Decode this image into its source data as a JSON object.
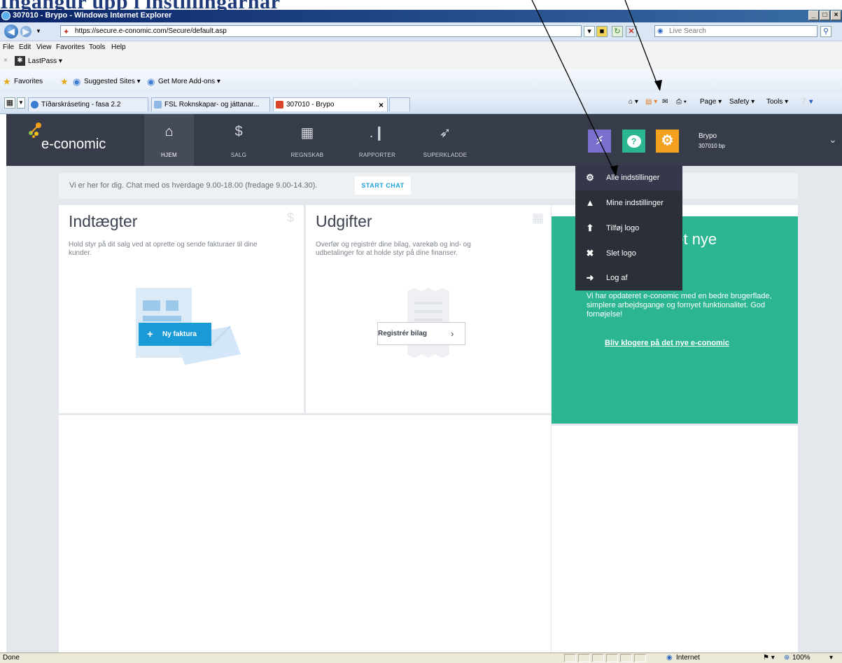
{
  "doc_heading": "Ingangur upp í instillingarnar",
  "window": {
    "title": "307010 - Brypo - Windows Internet Explorer",
    "controls": [
      "_",
      "□",
      "×"
    ]
  },
  "address_bar": {
    "url": "https://secure.e-conomic.com/Secure/default.asp",
    "search_placeholder": "Live Search"
  },
  "menu": [
    "File",
    "Edit",
    "View",
    "Favorites",
    "Tools",
    "Help"
  ],
  "lastpass": {
    "close": "×",
    "label": "LastPass ▾"
  },
  "favorites_bar": {
    "favorites": "Favorites",
    "suggested": "Suggested Sites ▾",
    "addons": "Get More Add-ons ▾"
  },
  "tabs": [
    {
      "label": "Tíðarskráseting - fasa 2.2"
    },
    {
      "label": "FSL Roknskapar- og játtanar..."
    },
    {
      "label": "307010 - Brypo"
    }
  ],
  "tab_close": "×",
  "command_bar": {
    "page": "Page ▾",
    "safety": "Safety ▾",
    "tools": "Tools ▾"
  },
  "app": {
    "logo": "e-conomic",
    "nav": [
      {
        "label": "HJEM",
        "icon": "⌂"
      },
      {
        "label": "SALG",
        "icon": "$"
      },
      {
        "label": "REGNSKAB",
        "icon": "▦"
      },
      {
        "label": "RAPPORTER",
        "icon": ".❙"
      },
      {
        "label": "SUPERKLADDE",
        "icon": "➶"
      }
    ],
    "user": {
      "name": "Brypo",
      "company": "307010 bp"
    },
    "colors": {
      "header": "#363c49",
      "lightning": "#7b6fd0",
      "chat": "#2bb590",
      "gear": "#f5a01f"
    }
  },
  "chat_bar": {
    "message": "Vi er her for dig. Chat med os hverdage 9.00-18.00 (fredage 9.00-14.30).",
    "button": "START CHAT"
  },
  "cards": {
    "income": {
      "title": "Indtægter",
      "desc_line1": "Hold styr på dit salg ved at oprette og sende fakturaer til dine",
      "desc_line2": "kunder.",
      "button": "Ny faktura"
    },
    "expenses": {
      "title": "Udgifter",
      "desc_line1": "Overfør og registrér dine bilag, varekøb og ind- og",
      "desc_line2": "udbetalinger for at holde styr på dine finanser.",
      "button": "Registrér bilag"
    }
  },
  "promo": {
    "heading": "til det nye",
    "body": "Vi har opdateret e-conomic med en bedre brugerflade, simplere arbejdsgange og fornyet funktionalitet. God fornøjelse!",
    "link": "Bliv klogere på det nye e-conomic"
  },
  "dropdown": [
    {
      "label": "Alle indstillinger",
      "icon": "⚙"
    },
    {
      "label": "Mine indstillinger",
      "icon": "▲"
    },
    {
      "label": "Tilføj logo",
      "icon": "⬆"
    },
    {
      "label": "Slet logo",
      "icon": "✖"
    },
    {
      "label": "Log af",
      "icon": "➜"
    }
  ],
  "status_bar": {
    "left": "Done",
    "zone": "Internet",
    "zoom": "100%"
  }
}
